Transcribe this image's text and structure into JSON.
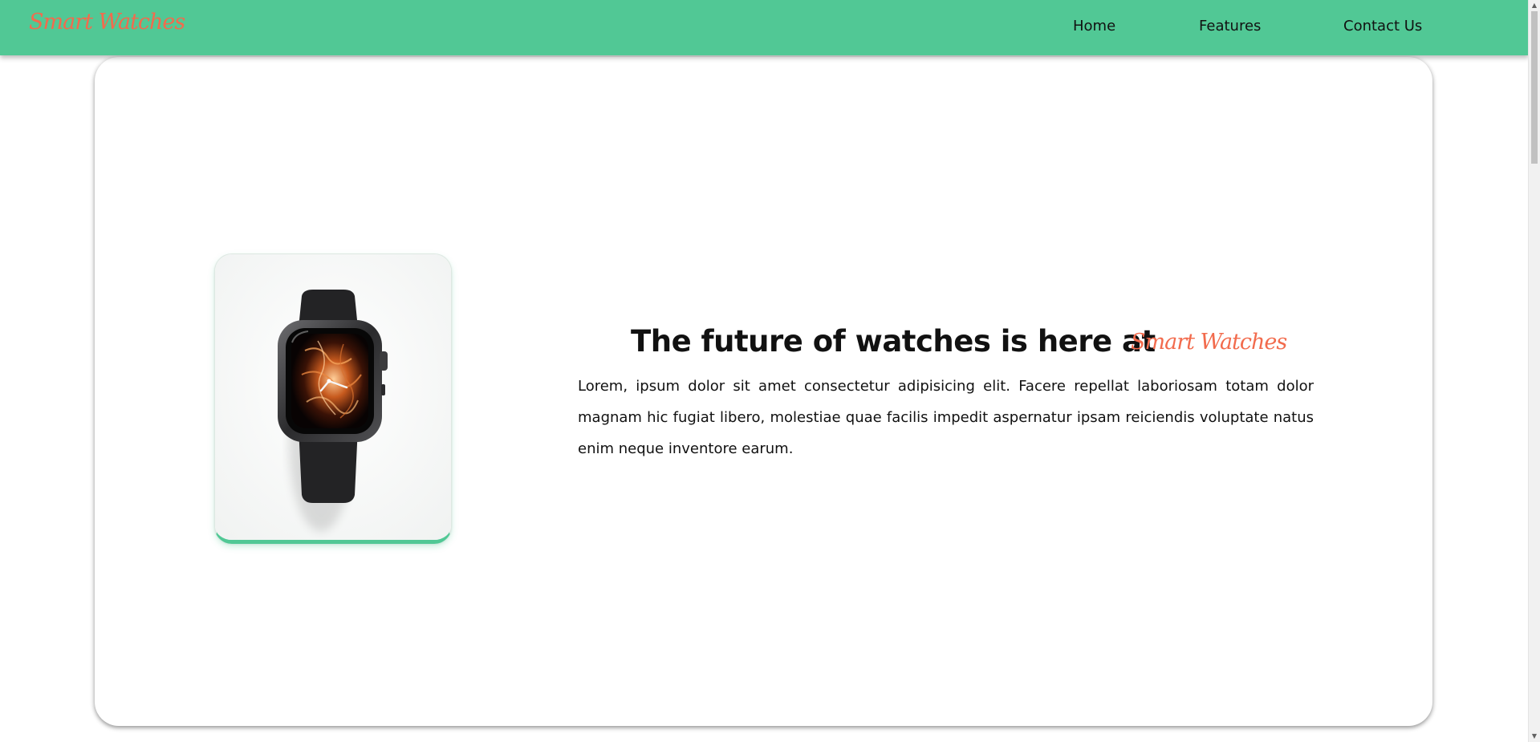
{
  "nav": {
    "brand": "Smart Watches",
    "links": [
      {
        "label": "Home"
      },
      {
        "label": "Features"
      },
      {
        "label": "Contact Us"
      }
    ]
  },
  "hero": {
    "headline": "The future of watches is here at",
    "headline_brand": "Smart Watches",
    "description": "Lorem, ipsum dolor sit amet consectetur adipisicing elit. Facere repellat laboriosam totam dolor magnam hic fugiat libero, molestiae quae facilis impedit aspernatur ipsam reiciendis voluptate natus enim neque inventore earum.",
    "image": {
      "icon": "smartwatch-image"
    }
  },
  "colors": {
    "accent": "#51c895",
    "brand": "#f26b4d"
  }
}
